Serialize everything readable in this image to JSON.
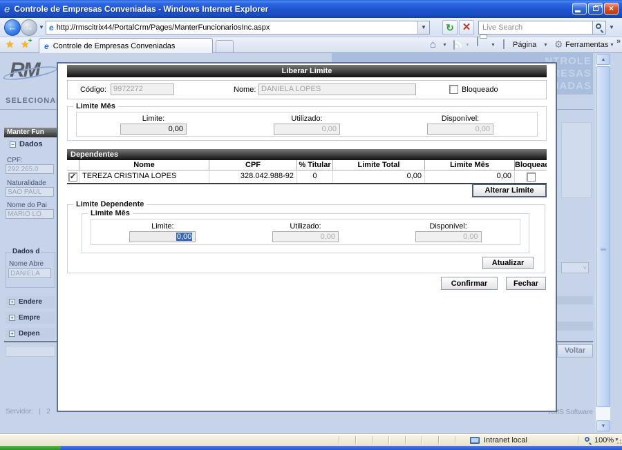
{
  "title_bar": {
    "title": "Controle de Empresas Conveniadas - Windows Internet Explorer"
  },
  "address_bar": {
    "url": "http://rmscitrix44/PortalCrm/Pages/ManterFuncionariosInc.aspx",
    "search_placeholder": "Live Search"
  },
  "tabs": {
    "active": "Controle de Empresas Conveniadas"
  },
  "command_bar": {
    "page": "Página",
    "tools": "Ferramentas",
    "overflow": "»"
  },
  "background": {
    "logo": "RM",
    "banner_line1": "NTROLE",
    "banner_line2": "MPRESAS",
    "banner_line3": "ENIADAS",
    "selecionar": "SELECIONAR",
    "panel_header": "Manter Fun",
    "dados_label": "Dados",
    "cpf_label": "CPF:",
    "cpf_value": "292.265.0",
    "naturalidade_label": "Naturalidade",
    "naturalidade_value": "SAO PAUL",
    "pai_label": "Nome do Pai",
    "pai_value": "MARIO LO",
    "dados_dep_label": "Dados d",
    "nome_abre_label": "Nome Abre",
    "nome_abre_value": "DANIELA",
    "expander_1": "Endere",
    "expander_2": "Empre",
    "expander_3": "Depen",
    "voltar": "Voltar",
    "servidor": "Servidor:   |   2",
    "rms": "RMS Software"
  },
  "modal": {
    "title": "Liberar Limite",
    "codigo_label": "Código:",
    "codigo_value": "9972272",
    "nome_label": "Nome:",
    "nome_value": "DANIELA LOPES",
    "bloqueado_label": "Bloqueado",
    "limite_mes": {
      "legend": "Limite Mês",
      "limite_label": "Limite:",
      "limite_value": "0,00",
      "utilizado_label": "Utilizado:",
      "utilizado_value": "0,00",
      "disponivel_label": "Disponível:",
      "disponivel_value": "0,00"
    },
    "dependentes": {
      "header": "Dependentes",
      "col_nome": "Nome",
      "col_cpf": "CPF",
      "col_titular": "% Titular",
      "col_limite_total": "Limite Total",
      "col_limite_mes": "Limite Mês",
      "col_bloqueado": "Bloqueado",
      "row": {
        "nome": "TEREZA CRISTINA LOPES",
        "cpf": "328.042.988-92",
        "titular": "0",
        "limite_total": "0,00",
        "limite_mes": "0,00"
      }
    },
    "alterar_button": "Alterar Limite",
    "limite_dependente": {
      "legend": "Limite Dependente",
      "inner_legend": "Limite Mês",
      "limite_label": "Limite:",
      "limite_value": "0,00",
      "utilizado_label": "Utilizado:",
      "utilizado_value": "0,00",
      "disponivel_label": "Disponível:",
      "disponivel_value": "0,00"
    },
    "atualizar_button": "Atualizar",
    "confirmar_button": "Confirmar",
    "fechar_button": "Fechar"
  },
  "status_bar": {
    "zone": "Intranet local",
    "zoom": "100%"
  }
}
